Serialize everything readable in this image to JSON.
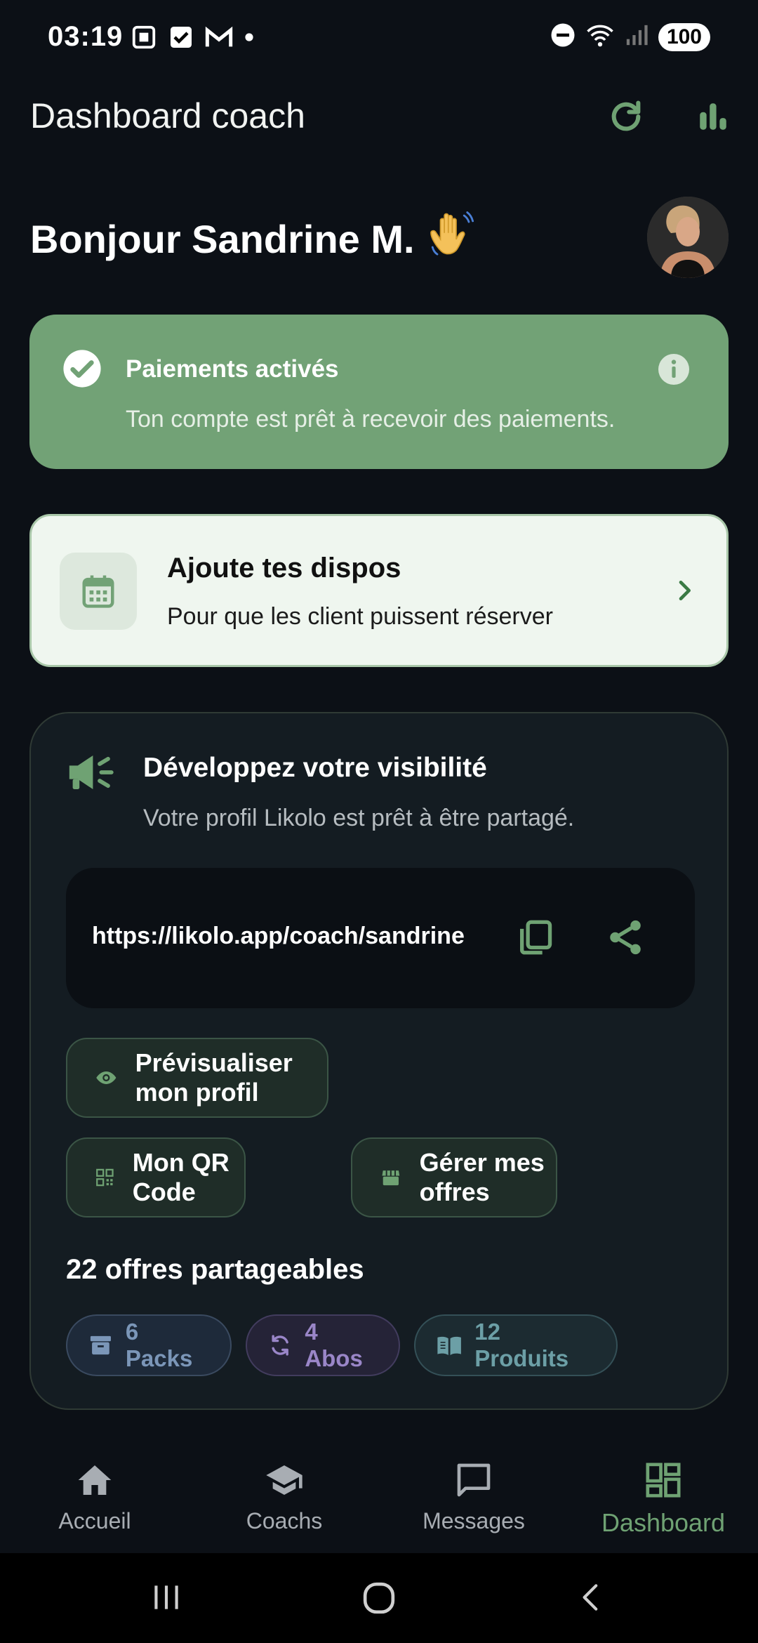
{
  "status_bar": {
    "time": "03:19",
    "battery": "100",
    "left_icons": [
      "screenshot-icon",
      "checkbox-icon",
      "gmail-icon",
      "dot-icon"
    ],
    "right_icons": [
      "do-not-disturb-icon",
      "wifi-icon",
      "signal-icon"
    ]
  },
  "app_bar": {
    "title": "Dashboard coach",
    "actions": [
      "refresh-icon",
      "stats-icon"
    ]
  },
  "greeting": {
    "text": "Bonjour Sandrine M.",
    "emoji": "👋"
  },
  "payment_card": {
    "title": "Paiements activés",
    "subtitle": "Ton compte est prêt à recevoir des paiements."
  },
  "dispo_card": {
    "title": "Ajoute tes dispos",
    "subtitle": "Pour que les client puissent réserver"
  },
  "visibility_card": {
    "title": "Développez votre visibilité",
    "subtitle": "Votre profil Likolo est prêt à être partagé.",
    "profile_link": "https://likolo.app/coach/sandrine",
    "preview_button": "Prévisualiser mon profil",
    "qr_button": "Mon QR Code",
    "offers_button": "Gérer mes offres",
    "offers_count_label": "22 offres partageables",
    "chips": {
      "packs": "6 Packs",
      "abos": "4 Abos",
      "produits": "12 Produits"
    }
  },
  "bottom_nav": {
    "items": [
      {
        "label": "Accueil",
        "icon": "home-icon"
      },
      {
        "label": "Coachs",
        "icon": "graduation-cap-icon"
      },
      {
        "label": "Messages",
        "icon": "message-icon"
      },
      {
        "label": "Dashboard",
        "icon": "dashboard-icon",
        "active": true
      }
    ]
  },
  "colors": {
    "accent_green": "#6fa273",
    "payment_card_bg": "#72a276",
    "background": "#0c1016",
    "chip_packs": "#7b96b8",
    "chip_abos": "#9a86c8",
    "chip_produits": "#6c9fa6"
  }
}
